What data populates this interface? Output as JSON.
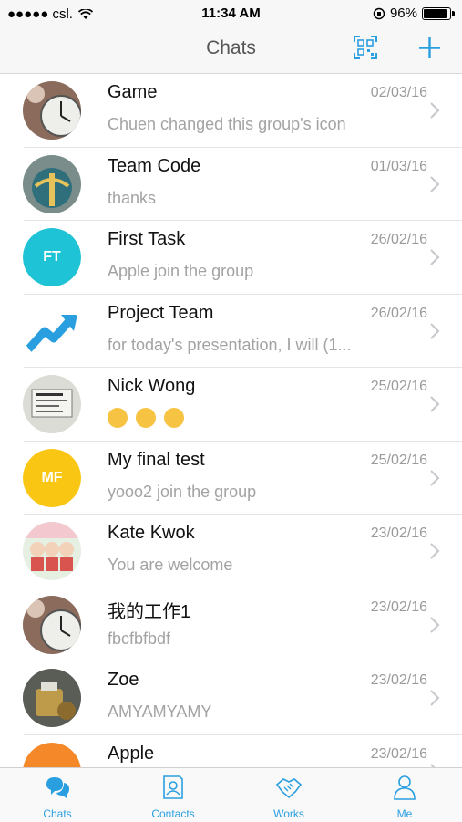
{
  "status_bar": {
    "carrier": "●●●●● csl.",
    "time": "11:34 AM",
    "battery": "96%",
    "battery_level": 0.96
  },
  "nav": {
    "title": "Chats"
  },
  "chats": [
    {
      "name": "Game",
      "date": "02/03/16",
      "preview": "Chuen changed this group's icon",
      "avatar": "photo-clock"
    },
    {
      "name": "Team Code",
      "date": "01/03/16",
      "preview": "thanks",
      "avatar": "photo-globe"
    },
    {
      "name": "First Task",
      "date": "26/02/16",
      "preview": "Apple join the group",
      "avatar_text": "FT",
      "avatar_color": "#1fc3d6"
    },
    {
      "name": "Project Team",
      "date": "26/02/16",
      "preview": "for today's presentation, I will (1...",
      "avatar": "arrow-chart"
    },
    {
      "name": "Nick Wong",
      "date": "25/02/16",
      "preview": "",
      "avatar": "photo-note",
      "emoji": [
        "laughing",
        "laughing",
        "laughing"
      ]
    },
    {
      "name": "My final test",
      "date": "25/02/16",
      "preview": "yooo2 join the group",
      "avatar_text": "MF",
      "avatar_color": "#f9c713"
    },
    {
      "name": "Kate Kwok",
      "date": "23/02/16",
      "preview": "You are welcome",
      "avatar": "photo-kids"
    },
    {
      "name": "我的工作1",
      "date": "23/02/16",
      "preview": "fbcfbfbdf",
      "avatar": "photo-clock"
    },
    {
      "name": "Zoe",
      "date": "23/02/16",
      "preview": "AMYAMYAMY",
      "avatar": "photo-food"
    },
    {
      "name": "Apple",
      "date": "23/02/16",
      "preview": "",
      "avatar_color": "#f5892a"
    }
  ],
  "tabs": [
    {
      "label": "Chats",
      "icon": "chat-bubbles-icon"
    },
    {
      "label": "Contacts",
      "icon": "contacts-icon"
    },
    {
      "label": "Works",
      "icon": "handshake-icon"
    },
    {
      "label": "Me",
      "icon": "person-icon"
    }
  ],
  "colors": {
    "accent": "#2a9fe0",
    "ft": "#1fc3d6",
    "mf": "#f9c713"
  }
}
